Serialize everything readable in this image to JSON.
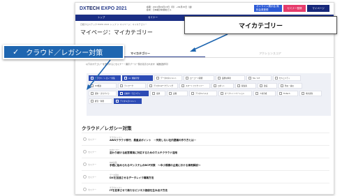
{
  "header": {
    "logo_prefix": "DX",
    "logo_main": "TECH",
    "logo_suffix": " EXPO 2021",
    "dates_line1": "会期：2021年09月13日（月）~09月15日（金）",
    "dates_line2": "会場：日本経済新聞社ビル",
    "btn_register": "オンライン展示会 無料会員登録",
    "btn_seminar": "セミナー登録",
    "btn_mypage": "マイページ"
  },
  "nav": [
    "トップ",
    "セミナー",
    "テーマ一覧",
    "出展者一覧",
    "お知らせ"
  ],
  "breadcrumb": "日経クロステック EXPO 2021 トップ ＞ マイページ：マイカテゴリー",
  "page_title": "マイページ：マイカテゴリー",
  "tabs": [
    {
      "label": "マイカテゴリー",
      "active": true
    },
    {
      "label": "アクションスコア",
      "active": false
    }
  ],
  "description": "以下のカテゴリーを選択するとセミナー・展示ブース一覧が表示されます（複数選択可）",
  "chips": [
    {
      "label": "クラウド／レガシー対策",
      "on": true
    },
    {
      "label": "AI／機械学習",
      "on": true
    },
    {
      "label": "データマネジメント",
      "on": false
    },
    {
      "label": "ローコード開発",
      "on": false
    },
    {
      "label": "業務効率化",
      "on": false
    },
    {
      "label": "5G／IoT",
      "on": false
    },
    {
      "label": "セキュリティ",
      "on": false
    },
    {
      "label": "DX推進",
      "on": false
    },
    {
      "label": "テレワーク",
      "on": false
    },
    {
      "label": "デジタルマーケティング",
      "on": false
    },
    {
      "label": "スマートファクトリー",
      "on": false
    },
    {
      "label": "ロボット",
      "on": false
    },
    {
      "label": "脱炭素",
      "on": false
    },
    {
      "label": "建設",
      "on": false
    },
    {
      "label": "防災・減災",
      "on": false
    },
    {
      "label": "都市・まちづくり",
      "on": false
    },
    {
      "label": "自動車・モビリティ",
      "on": true
    },
    {
      "label": "電池",
      "on": false
    },
    {
      "label": "設備",
      "on": false
    },
    {
      "label": "デジタルヘルス",
      "on": false
    },
    {
      "label": "オープンイノベーション",
      "on": false
    },
    {
      "label": "人材育成",
      "on": false
    },
    {
      "label": "FinTech",
      "on": false
    },
    {
      "label": "地方創生",
      "on": false
    },
    {
      "label": "経営・財務",
      "on": false
    },
    {
      "label": "デジタルガバメント",
      "on": true
    }
  ],
  "section_title": "クラウド／レガシー対策",
  "articles": [
    {
      "like": "セミナー",
      "category": "クラウドシフト",
      "title": "AWSクラウド移行、最重点ポイント　－失敗しない社内稟議の作り方とは－"
    },
    {
      "like": "セミナー",
      "category": "DXセミナー",
      "title": "変わり続ける経営環境に対応するためのマルチクラウド活用"
    },
    {
      "like": "セミナー",
      "category": "BCP対策",
      "title": "手軽に始められるITシステムのBCP対策　～中小規模の企業における事例解説～"
    },
    {
      "like": "セミナー",
      "category": "データ活用",
      "title": "DXを加速させるデータレイク構築方法"
    },
    {
      "like": "セミナー",
      "category": "クラウドシフト",
      "title": "ITを変革させて新たなビジネス価値を生み出す方法"
    }
  ],
  "callout_left": "クラウド／レガシー対策",
  "callout_right": "マイカテゴリー"
}
